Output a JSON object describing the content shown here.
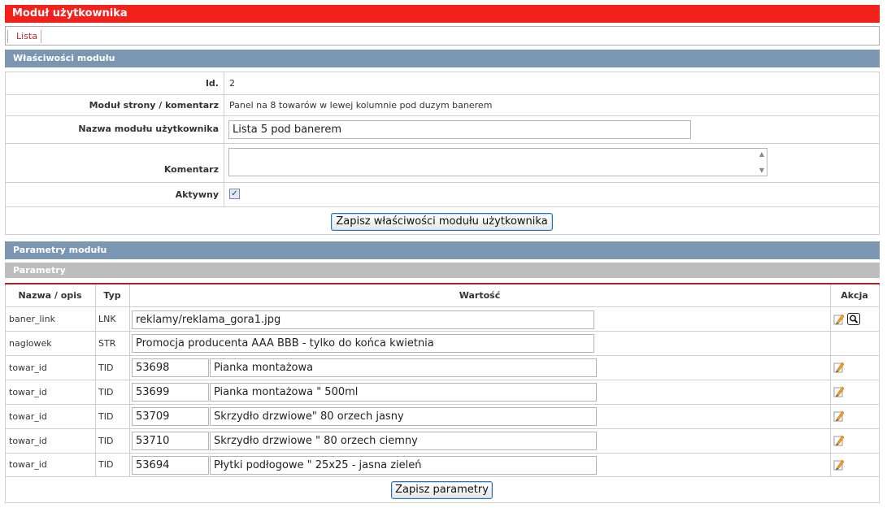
{
  "header": {
    "title": "Moduł użytkownika"
  },
  "tabs": [
    {
      "label": "Lista"
    }
  ],
  "properties": {
    "section_title": "Właściwości modułu",
    "id_label": "Id.",
    "id_value": "2",
    "module_label": "Moduł strony / komentarz",
    "module_value": "Panel na 8 towarów w lewej kolumnie pod duzym banerem",
    "name_label": "Nazwa modułu użytkownika",
    "name_value": "Lista 5 pod banerem",
    "comment_label": "Komentarz",
    "comment_value": "",
    "active_label": "Aktywny",
    "active_checked": true,
    "save_button": "Zapisz właściwości modułu użytkownika"
  },
  "params": {
    "section_title": "Parametry modułu",
    "subsection_title": "Parametry",
    "headers": {
      "name": "Nazwa / opis",
      "type": "Typ",
      "value": "Wartość",
      "action": "Akcja"
    },
    "rows": [
      {
        "name": "baner_link",
        "type": "LNK",
        "value": "reklamy/reklama_gora1.jpg",
        "icons": [
          "pencil-icon",
          "magnifier-icon"
        ]
      },
      {
        "name": "naglowek",
        "type": "STR",
        "value": "Promocja producenta AAA BBB - tylko do końca kwietnia",
        "icons": []
      },
      {
        "name": "towar_id",
        "type": "TID",
        "id": "53698",
        "value": "Pianka montażowa",
        "icons": [
          "pencil-icon"
        ]
      },
      {
        "name": "towar_id",
        "type": "TID",
        "id": "53699",
        "value": "Pianka montażowa \" 500ml",
        "icons": [
          "pencil-icon"
        ]
      },
      {
        "name": "towar_id",
        "type": "TID",
        "id": "53709",
        "value": "Skrzydło drzwiowe\" 80 orzech jasny",
        "icons": [
          "pencil-icon"
        ]
      },
      {
        "name": "towar_id",
        "type": "TID",
        "id": "53710",
        "value": "Skrzydło drzwiowe \" 80 orzech ciemny",
        "icons": [
          "pencil-icon"
        ]
      },
      {
        "name": "towar_id",
        "type": "TID",
        "id": "53694",
        "value": "Płytki podłogowe \" 25x25 - jasna zieleń",
        "icons": [
          "pencil-icon"
        ]
      }
    ],
    "save_button": "Zapisz parametry"
  },
  "colors": {
    "title_bar": "#f2211b",
    "section_bar": "#7b96b1",
    "subsection_bar": "#bdbdbd",
    "table_rule": "#a6242a",
    "button_border": "#2e74b5"
  }
}
